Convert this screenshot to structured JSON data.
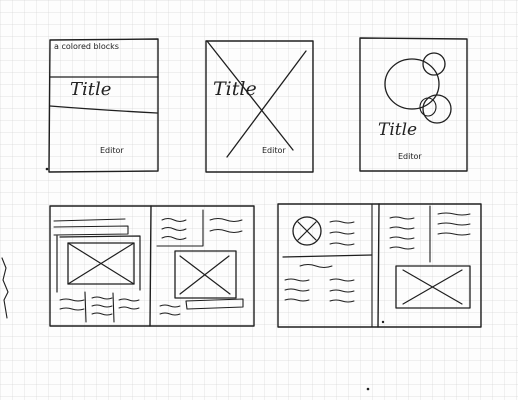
{
  "sketch": {
    "page1": {
      "note": "a colored blocks",
      "title": "Title",
      "editor": "Editor"
    },
    "page2": {
      "title": "Title",
      "editor": "Editor"
    },
    "page3": {
      "title": "Title",
      "editor": "Editor"
    }
  },
  "colors": {
    "paper": "#fdfdfd",
    "grid": "#d7d7d7",
    "ink": "#1f1f1f"
  }
}
